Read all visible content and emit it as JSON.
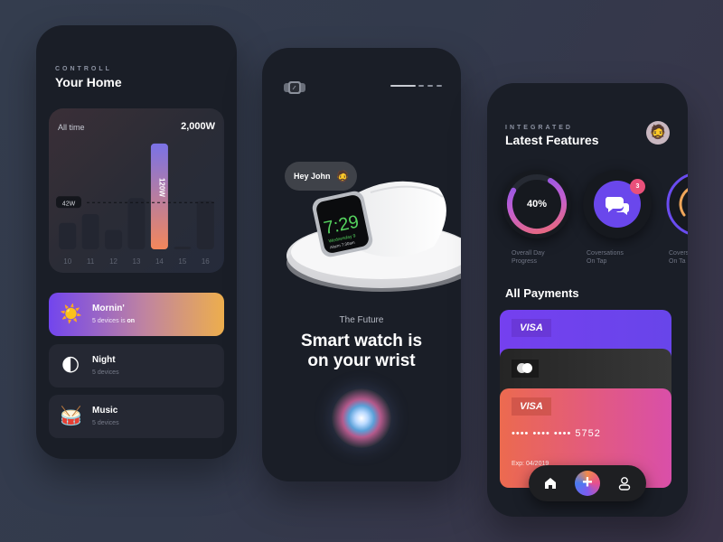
{
  "home": {
    "eyebrow": "CONTROLL",
    "title": "Your Home",
    "chart_card": {
      "period_label": "All time",
      "total": "2,000W"
    },
    "scenes": [
      {
        "name": "Mornin'",
        "sub_prefix": "5 devices is ",
        "sub_bold": "on",
        "icon": "sun-icon",
        "emoji": "☀️",
        "active": true
      },
      {
        "name": "Night",
        "sub_prefix": "5 devices",
        "sub_bold": "",
        "icon": "moon-icon",
        "emoji": "🌓",
        "active": false
      },
      {
        "name": "Music",
        "sub_prefix": "5 devices",
        "sub_bold": "",
        "icon": "drum-icon",
        "emoji": "🥁",
        "active": false
      }
    ]
  },
  "chart_data": {
    "type": "bar",
    "title": "All time",
    "total_label": "2,000W",
    "categories": [
      "10",
      "11",
      "12",
      "13",
      "14",
      "15",
      "16"
    ],
    "values": [
      30,
      40,
      22,
      58,
      120,
      2,
      55
    ],
    "highlight_index": 4,
    "highlight_label": "120W",
    "reference_line": {
      "value": 53,
      "label": "42W"
    },
    "ylim": [
      0,
      125
    ],
    "xlabel": "",
    "ylabel": "",
    "colors": {
      "bar": "#232631",
      "highlight_top": "#7a72e6",
      "highlight_bottom": "#f3875b"
    }
  },
  "watch": {
    "greeting": "Hey John",
    "greeting_emoji": "🧔",
    "watch_time": "7:29",
    "watch_day": "Wednesday 9",
    "watch_alarm": "Alarm 7:30am",
    "eyebrow": "The Future",
    "headline_line1": "Smart watch is",
    "headline_line2": "on your wrist",
    "pager_active": 0,
    "pager_count": 4
  },
  "features": {
    "eyebrow": "INTEGRATED",
    "title": "Latest Features",
    "avatar_emoji": "🧔",
    "items": [
      {
        "label_line1": "Overall Day",
        "label_line2": "Progress",
        "value": "40%",
        "progress": 0.4
      },
      {
        "label_line1": "Coversations",
        "label_line2": "On Tap",
        "badge": "3"
      },
      {
        "label_line1": "Covers",
        "label_line2": "On Ta"
      }
    ],
    "payments_title": "All Payments",
    "cards": [
      {
        "brand": "VISA"
      },
      {
        "brand": "mastercard"
      },
      {
        "brand": "VISA",
        "number": "••••   ••••   ••••   5752",
        "expiry": "Exp: 04/2019"
      }
    ],
    "nav": {
      "home": "home-icon",
      "add": "+",
      "profile": "profile-icon"
    }
  }
}
